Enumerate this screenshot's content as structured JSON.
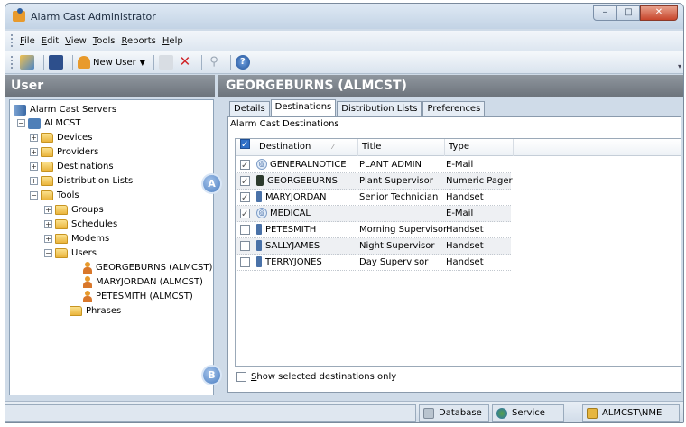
{
  "window": {
    "title": "Alarm Cast Administrator",
    "controls": [
      "–",
      "□",
      "✕"
    ]
  },
  "menu": [
    "File",
    "Edit",
    "View",
    "Tools",
    "Reports",
    "Help"
  ],
  "toolbar": {
    "new_user_label": "New User"
  },
  "left_header": "User",
  "right_header": "GEORGEBURNS (ALMCST)",
  "tree": {
    "root": "Alarm Cast Servers",
    "server": "ALMCST",
    "devices": "Devices",
    "providers": "Providers",
    "destinations": "Destinations",
    "distribution_lists": "Distribution Lists",
    "tools": "Tools",
    "groups": "Groups",
    "schedules": "Schedules",
    "modems": "Modems",
    "users": "Users",
    "user1": "GEORGEBURNS (ALMCST)",
    "user2": "MARYJORDAN (ALMCST)",
    "user3": "PETESMITH (ALMCST)",
    "phrases": "Phrases"
  },
  "tabs": [
    "Details",
    "Destinations",
    "Distribution Lists",
    "Preferences"
  ],
  "group_label": "Alarm Cast Destinations",
  "grid": {
    "columns": [
      "Destination",
      "Title",
      "Type"
    ],
    "rows": [
      {
        "name": "GENERALNOTICE",
        "title": "PLANT ADMIN",
        "type": "E-Mail",
        "checked": true,
        "device": "email"
      },
      {
        "name": "GEORGEBURNS",
        "title": "Plant Supervisor",
        "type": "Numeric Pager",
        "checked": true,
        "device": "pager"
      },
      {
        "name": "MARYJORDAN",
        "title": "Senior Technician",
        "type": "Handset",
        "checked": true,
        "device": "handset"
      },
      {
        "name": "MEDICAL",
        "title": "",
        "type": "E-Mail",
        "checked": true,
        "device": "email"
      },
      {
        "name": "PETESMITH",
        "title": "Morning Supervisor",
        "type": "Handset",
        "checked": false,
        "device": "handset"
      },
      {
        "name": "SALLYJAMES",
        "title": "Night Supervisor",
        "type": "Handset",
        "checked": false,
        "device": "handset"
      },
      {
        "name": "TERRYJONES",
        "title": "Day Supervisor",
        "type": "Handset",
        "checked": false,
        "device": "handset"
      }
    ]
  },
  "show_selected_label": "Show selected destinations only",
  "callouts": {
    "a": "A",
    "b": "B"
  },
  "status": {
    "database": "Database",
    "service": "Service",
    "user": "ALMCST\\NME"
  },
  "colors": {
    "accent": "#2f6fc6",
    "header_gray": "#7d848c",
    "folder": "#eab53d",
    "user_orange": "#e89a2c"
  }
}
